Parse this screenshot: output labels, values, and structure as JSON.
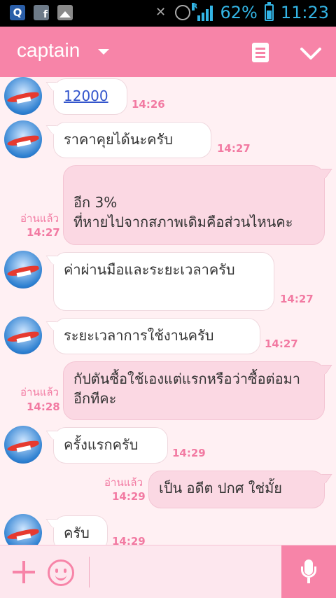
{
  "status_bar": {
    "signal_label": "R",
    "battery": "62%",
    "time": "11:23"
  },
  "header": {
    "title": "captain"
  },
  "messages": [
    {
      "side": "in",
      "text": "12000",
      "time": "14:26",
      "is_link": true
    },
    {
      "side": "in",
      "text": "ราคาคุยได้นะครับ",
      "time": "14:27"
    },
    {
      "side": "out",
      "text": "อีก 3%\nที่หายไปจากสภาพเดิมคือส่วนไหนคะ",
      "time": "14:27",
      "read": "อ่านแล้ว"
    },
    {
      "side": "in",
      "text": "ค่าผ่านมือและระยะเวลาครับ",
      "time": "14:27"
    },
    {
      "side": "in",
      "text": "ระยะเวลาการใช้งานครับ",
      "time": "14:27"
    },
    {
      "side": "out",
      "text": "กัปตันซื้อใช้เองแต่แรกหรือว่าซื้อต่อมาอีกทีคะ",
      "time": "14:28",
      "read": "อ่านแล้ว"
    },
    {
      "side": "in",
      "text": "ครั้งแรกครับ",
      "time": "14:29"
    },
    {
      "side": "out",
      "text": "เป็น อดีต ปกศ ใช่มั้ย",
      "time": "14:29",
      "read": "อ่านแล้ว"
    },
    {
      "side": "in",
      "text": "ครับ",
      "time": "14:29"
    }
  ],
  "colors": {
    "accent": "#f784a8",
    "bubble_out": "#fbd8e3",
    "bubble_in": "#ffffff",
    "timestamp": "#f27aa2",
    "link": "#3355cc"
  }
}
